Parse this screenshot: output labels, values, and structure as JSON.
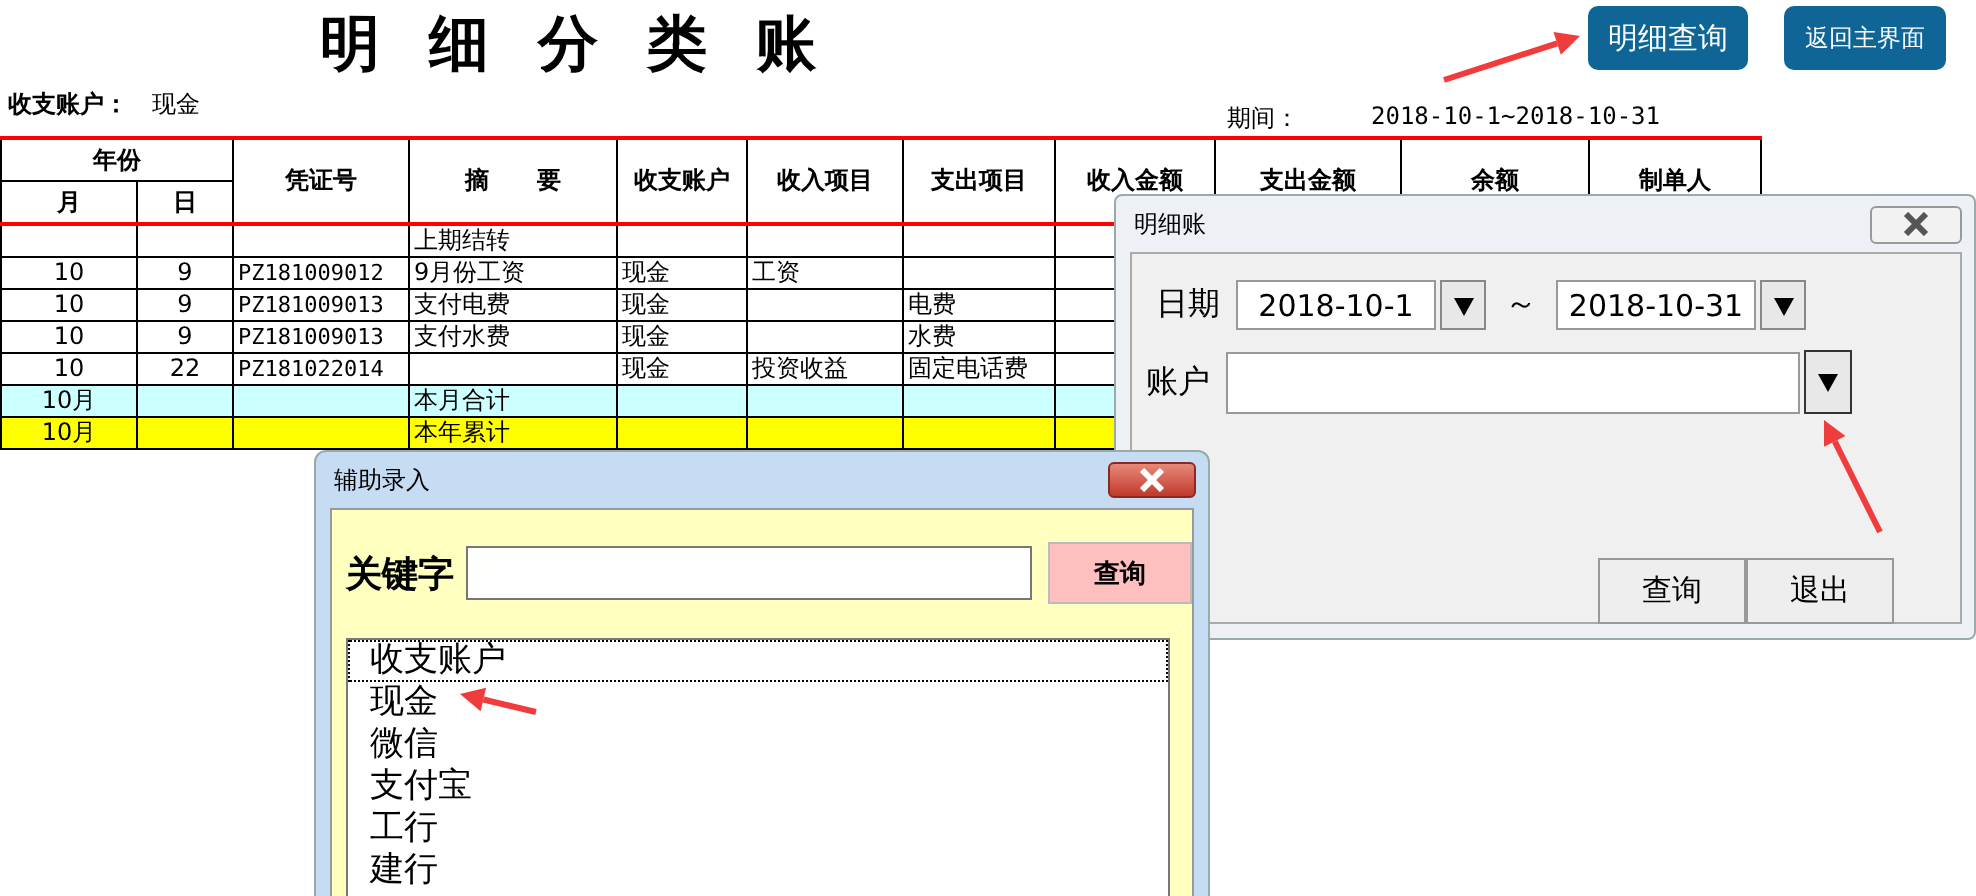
{
  "sheet": {
    "title": "明 细 分 类 账",
    "account_label": "收支账户：",
    "account_value": "现金",
    "period_label": "期间：",
    "period_value": "2018-10-1~2018-10-31",
    "header": {
      "year": "年份",
      "month": "月",
      "day": "日",
      "columns": [
        "凭证号",
        "摘　　要",
        "收支账户",
        "收入项目",
        "支出项目",
        "收入金额",
        "支出金额",
        "余额",
        "制单人"
      ]
    },
    "rows": [
      {
        "kind": "carry",
        "summary": "上期结转"
      },
      {
        "kind": "entry",
        "month": "10",
        "day": "9",
        "voucher": "PZ181009012",
        "summary": "9月份工资",
        "account": "现金",
        "income_item": "工资"
      },
      {
        "kind": "entry",
        "month": "10",
        "day": "9",
        "voucher": "PZ181009013",
        "summary": "支付电费",
        "account": "现金",
        "expense_item": "电费"
      },
      {
        "kind": "entry",
        "month": "10",
        "day": "9",
        "voucher": "PZ181009013",
        "summary": "支付水费",
        "account": "现金",
        "expense_item": "水费"
      },
      {
        "kind": "entry",
        "month": "10",
        "day": "22",
        "voucher": "PZ181022014",
        "account": "现金",
        "income_item": "投资收益",
        "expense_item": "固定电话费"
      },
      {
        "kind": "month_total",
        "month": "10月",
        "summary": "本月合计"
      },
      {
        "kind": "year_total",
        "month": "10月",
        "summary": "本年累计"
      }
    ]
  },
  "top_buttons": [
    "明细查询",
    "返回主界面"
  ],
  "detail_dialog": {
    "title": "明细账",
    "date_label": "日期",
    "date_from": "2018-10-1",
    "range_separator": "～",
    "date_to": "2018-10-31",
    "account_label": "账户",
    "buttons": [
      "查询",
      "退出"
    ]
  },
  "aux_dialog": {
    "title": "辅助录入",
    "keyword_label": "关键字",
    "search_button": "查询",
    "items": [
      {
        "label": "收支账户",
        "selected": true
      },
      {
        "label": "现金",
        "selected": false
      },
      {
        "label": "微信",
        "selected": false
      },
      {
        "label": "支付宝",
        "selected": false
      },
      {
        "label": "工行",
        "selected": false
      },
      {
        "label": "建行",
        "selected": false
      }
    ]
  }
}
